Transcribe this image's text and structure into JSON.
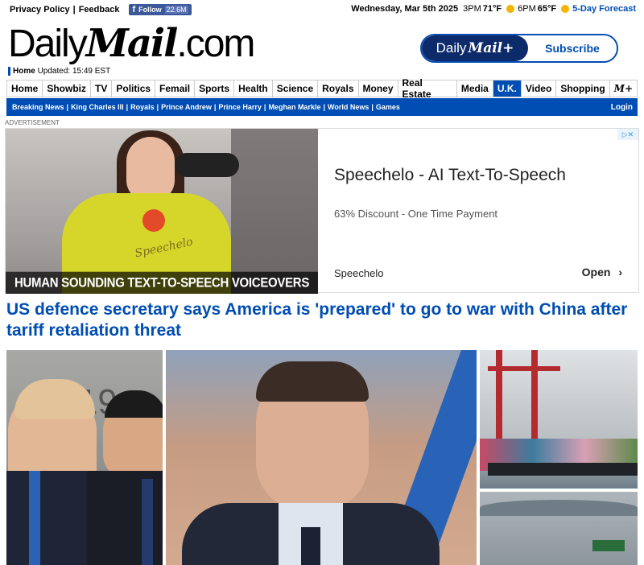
{
  "topbar": {
    "privacy": "Privacy Policy",
    "feedback": "Feedback",
    "fb_label": "Follow",
    "fb_count": "22.6M",
    "date": "Wednesday, Mar 5th 2025",
    "t1": "3PM",
    "temp1": "71°F",
    "t2": "6PM",
    "temp2": "65°F",
    "forecast": "5-Day Forecast"
  },
  "masthead": {
    "logo_daily": "Daily",
    "logo_mail": "Mail",
    "logo_com": ".com",
    "home": "Home",
    "updated": "Updated: 15:49 EST",
    "sub_daily": "Daily",
    "sub_mail": "Mail+",
    "subscribe": "Subscribe"
  },
  "nav": [
    "Home",
    "Showbiz",
    "TV",
    "Politics",
    "Femail",
    "Sports",
    "Health",
    "Science",
    "Royals",
    "Money",
    "Real Estate",
    "Media",
    "U.K.",
    "Video",
    "Shopping",
    "M+"
  ],
  "subnav": [
    "Breaking News",
    "King Charles III",
    "Royals",
    "Prince Andrew",
    "Prince Harry",
    "Meghan Markle",
    "World News",
    "Games"
  ],
  "login": "Login",
  "ad": {
    "label": "ADVERTISEMENT",
    "banner": "HUMAN SOUNDING TEXT-TO-SPEECH VOICEOVERS",
    "headline": "Speechelo - AI Text-To-Speech",
    "desc": "63% Discount - One Time Payment",
    "sponsor": "Speechelo",
    "open": "Open",
    "mark_text": "Speechelo"
  },
  "story": {
    "title": "US defence secretary says America is 'prepared' to go to war with China after tariff retaliation threat",
    "backdrop_text": "2019"
  }
}
